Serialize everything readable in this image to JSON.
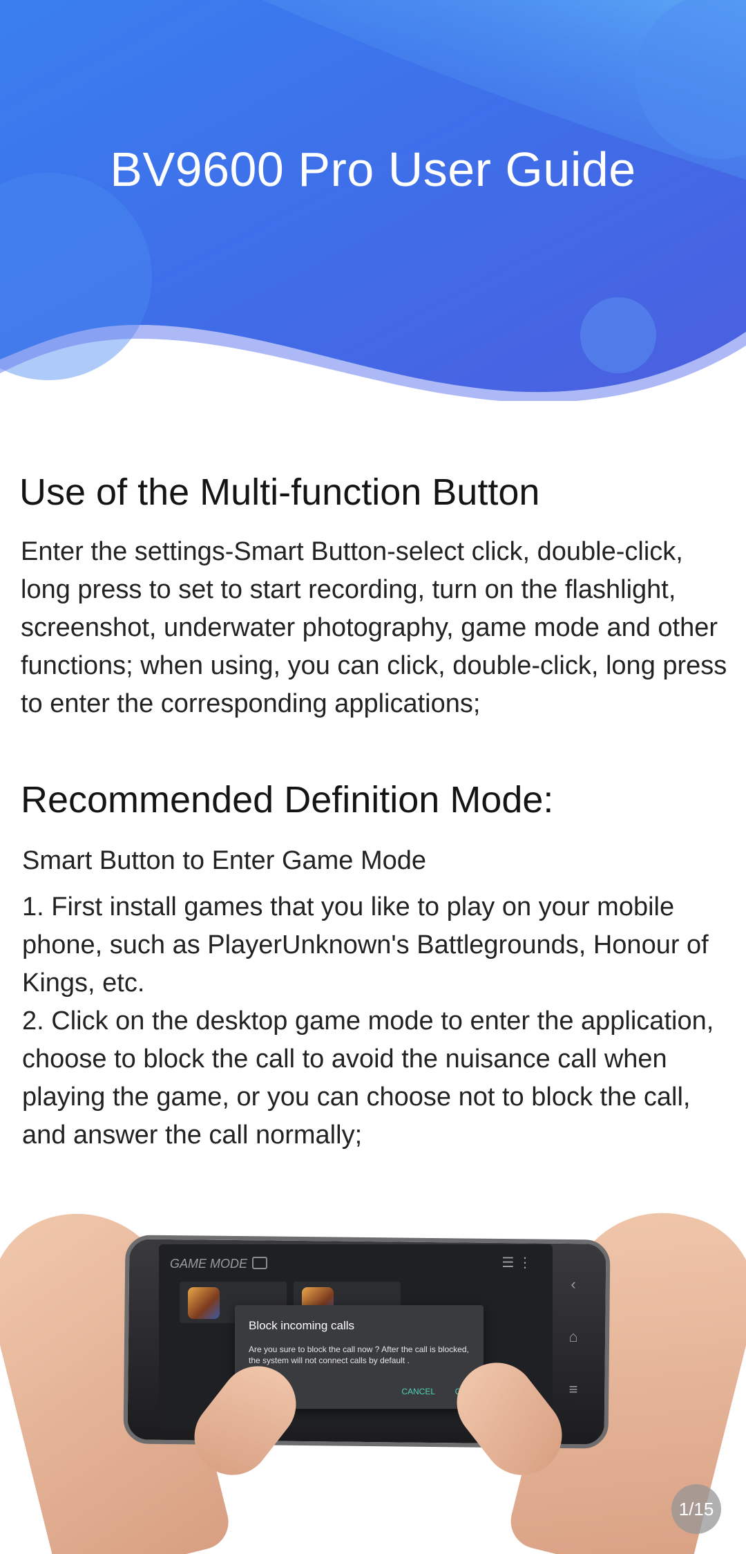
{
  "hero": {
    "title": "BV9600 Pro User Guide"
  },
  "section1": {
    "title": "Use of the Multi-function Button",
    "body": "Enter the settings-Smart Button-select click, double-click, long press to set to start recording, turn on the flashlight, screenshot, underwater photography, game mode and other functions; when using, you can click, double-click, long press to enter the corresponding applications;"
  },
  "section2": {
    "title": "Recommended Definition Mode:",
    "subhead": "Smart Button to Enter Game Mode",
    "step1": "1. First install games that you like to play on your mobile phone, such as PlayerUnknown's Battlegrounds, Honour of Kings, etc.",
    "step2": "2. Click on the desktop game mode to enter the application, choose to block the call to avoid the nuisance call when playing the game, or you can choose not to block the call, and answer the call normally;"
  },
  "photo": {
    "screen_label": "GAME MODE",
    "dialog": {
      "title": "Block incoming calls",
      "body": "Are you sure to block the call now ? After the call is blocked, the system will not connect calls by default .",
      "cancel": "CANCEL",
      "ok": "OK"
    },
    "nav_icons": [
      "back-icon",
      "home-icon",
      "menu-icon"
    ]
  },
  "pager": {
    "label": "1/15"
  },
  "colors": {
    "hero_top": "#4ea3f2",
    "hero_bottom": "#3b63e3",
    "accent": "#4fd1b5"
  }
}
